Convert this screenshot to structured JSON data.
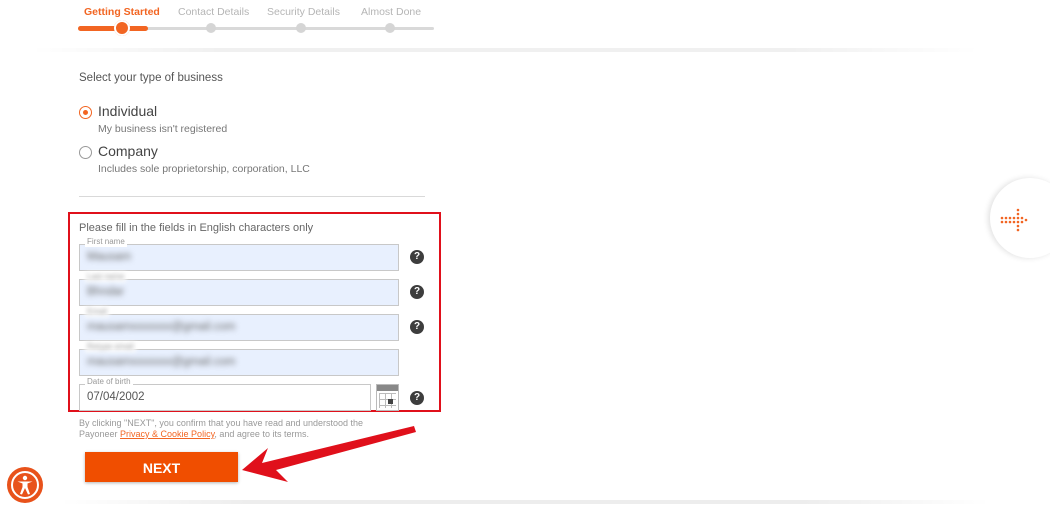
{
  "stepper": {
    "steps": [
      {
        "label": "Getting Started",
        "active": true
      },
      {
        "label": "Contact Details",
        "active": false
      },
      {
        "label": "Security Details",
        "active": false
      },
      {
        "label": "Almost Done",
        "active": false
      }
    ],
    "accent_color": "#f26522"
  },
  "business_type": {
    "prompt": "Select your type of business",
    "options": [
      {
        "label": "Individual",
        "description": "My business isn't registered",
        "selected": true
      },
      {
        "label": "Company",
        "description": "Includes sole proprietorship, corporation, LLC",
        "selected": false
      }
    ]
  },
  "form": {
    "note": "Please fill in the fields in English characters only",
    "fields": [
      {
        "label": "First name",
        "value": "Mausam"
      },
      {
        "label": "Last name",
        "value": "Bhndar"
      },
      {
        "label": "Email",
        "value": "mausamxxxxxxx@gmail.com"
      },
      {
        "label": "Retype email",
        "value": "mausamxxxxxxx@gmail.com"
      },
      {
        "label": "Date of birth",
        "value": "07/04/2002"
      }
    ],
    "help_icon_text": "?"
  },
  "consent": {
    "before": "By clicking \"NEXT\", you confirm that you have read and understood the Payoneer ",
    "link": "Privacy & Cookie Policy",
    "after": ", and agree to its terms."
  },
  "next_button": {
    "label": "NEXT",
    "color": "#f04e00"
  },
  "icons": {
    "accessibility": "accessibility-icon",
    "side_tab": "dotted-arrow-icon",
    "calendar": "calendar-icon",
    "help": "question-mark-icon"
  },
  "annotation_color": "#e0101b"
}
